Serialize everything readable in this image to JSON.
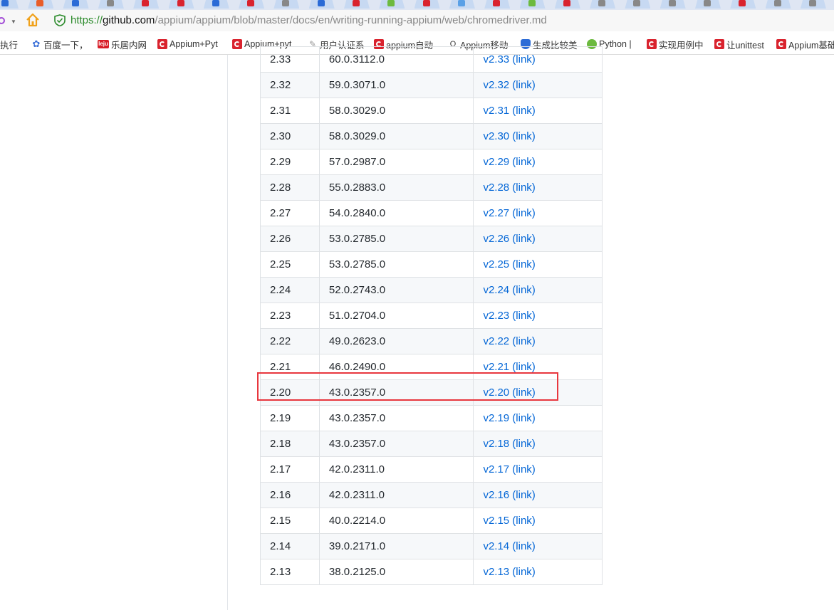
{
  "browser": {
    "url": {
      "protocol": "https://",
      "host": "github.com",
      "path": "/appium/appium/blob/master/docs/en/writing-running-appium/web/chromedriver.md"
    },
    "bookmarks": [
      {
        "label": "执行",
        "icon": "none"
      },
      {
        "label": "百度一下，",
        "icon": "baidu-paw-icon"
      },
      {
        "label": "乐居内网",
        "icon": "leju-icon"
      },
      {
        "label": "Appium+Pyt",
        "icon": "csdn-icon"
      },
      {
        "label": "Appium+pyt",
        "icon": "csdn-icon"
      },
      {
        "label": "用户认证系",
        "icon": "pen-icon"
      },
      {
        "label": "appium自动",
        "icon": "csdn-icon"
      },
      {
        "label": "Appium移动",
        "icon": "appium-icon"
      },
      {
        "label": "生成比较美",
        "icon": "shield-icon"
      },
      {
        "label": "Python |",
        "icon": "python-icon"
      },
      {
        "label": "实现用例中",
        "icon": "csdn-icon"
      },
      {
        "label": "让unittest",
        "icon": "csdn-icon"
      },
      {
        "label": "Appium基础",
        "icon": "csdn-icon"
      }
    ]
  },
  "table": {
    "rows": [
      {
        "driver": "2.33",
        "chrome": "60.0.3112.0",
        "link": "v2.33 (link)"
      },
      {
        "driver": "2.32",
        "chrome": "59.0.3071.0",
        "link": "v2.32 (link)"
      },
      {
        "driver": "2.31",
        "chrome": "58.0.3029.0",
        "link": "v2.31 (link)"
      },
      {
        "driver": "2.30",
        "chrome": "58.0.3029.0",
        "link": "v2.30 (link)"
      },
      {
        "driver": "2.29",
        "chrome": "57.0.2987.0",
        "link": "v2.29 (link)"
      },
      {
        "driver": "2.28",
        "chrome": "55.0.2883.0",
        "link": "v2.28 (link)"
      },
      {
        "driver": "2.27",
        "chrome": "54.0.2840.0",
        "link": "v2.27 (link)"
      },
      {
        "driver": "2.26",
        "chrome": "53.0.2785.0",
        "link": "v2.26 (link)"
      },
      {
        "driver": "2.25",
        "chrome": "53.0.2785.0",
        "link": "v2.25 (link)"
      },
      {
        "driver": "2.24",
        "chrome": "52.0.2743.0",
        "link": "v2.24 (link)"
      },
      {
        "driver": "2.23",
        "chrome": "51.0.2704.0",
        "link": "v2.23 (link)"
      },
      {
        "driver": "2.22",
        "chrome": "49.0.2623.0",
        "link": "v2.22 (link)"
      },
      {
        "driver": "2.21",
        "chrome": "46.0.2490.0",
        "link": "v2.21 (link)"
      },
      {
        "driver": "2.20",
        "chrome": "43.0.2357.0",
        "link": "v2.20 (link)"
      },
      {
        "driver": "2.19",
        "chrome": "43.0.2357.0",
        "link": "v2.19 (link)"
      },
      {
        "driver": "2.18",
        "chrome": "43.0.2357.0",
        "link": "v2.18 (link)"
      },
      {
        "driver": "2.17",
        "chrome": "42.0.2311.0",
        "link": "v2.17 (link)"
      },
      {
        "driver": "2.16",
        "chrome": "42.0.2311.0",
        "link": "v2.16 (link)"
      },
      {
        "driver": "2.15",
        "chrome": "40.0.2214.0",
        "link": "v2.15 (link)"
      },
      {
        "driver": "2.14",
        "chrome": "39.0.2171.0",
        "link": "v2.14 (link)"
      },
      {
        "driver": "2.13",
        "chrome": "38.0.2125.0",
        "link": "v2.13 (link)"
      }
    ],
    "highlighted_row": "2.21"
  },
  "colors": {
    "link": "#0366d6",
    "highlight": "#e8373e",
    "stripe": "#f6f8fa",
    "secure": "#2a8a2a"
  }
}
